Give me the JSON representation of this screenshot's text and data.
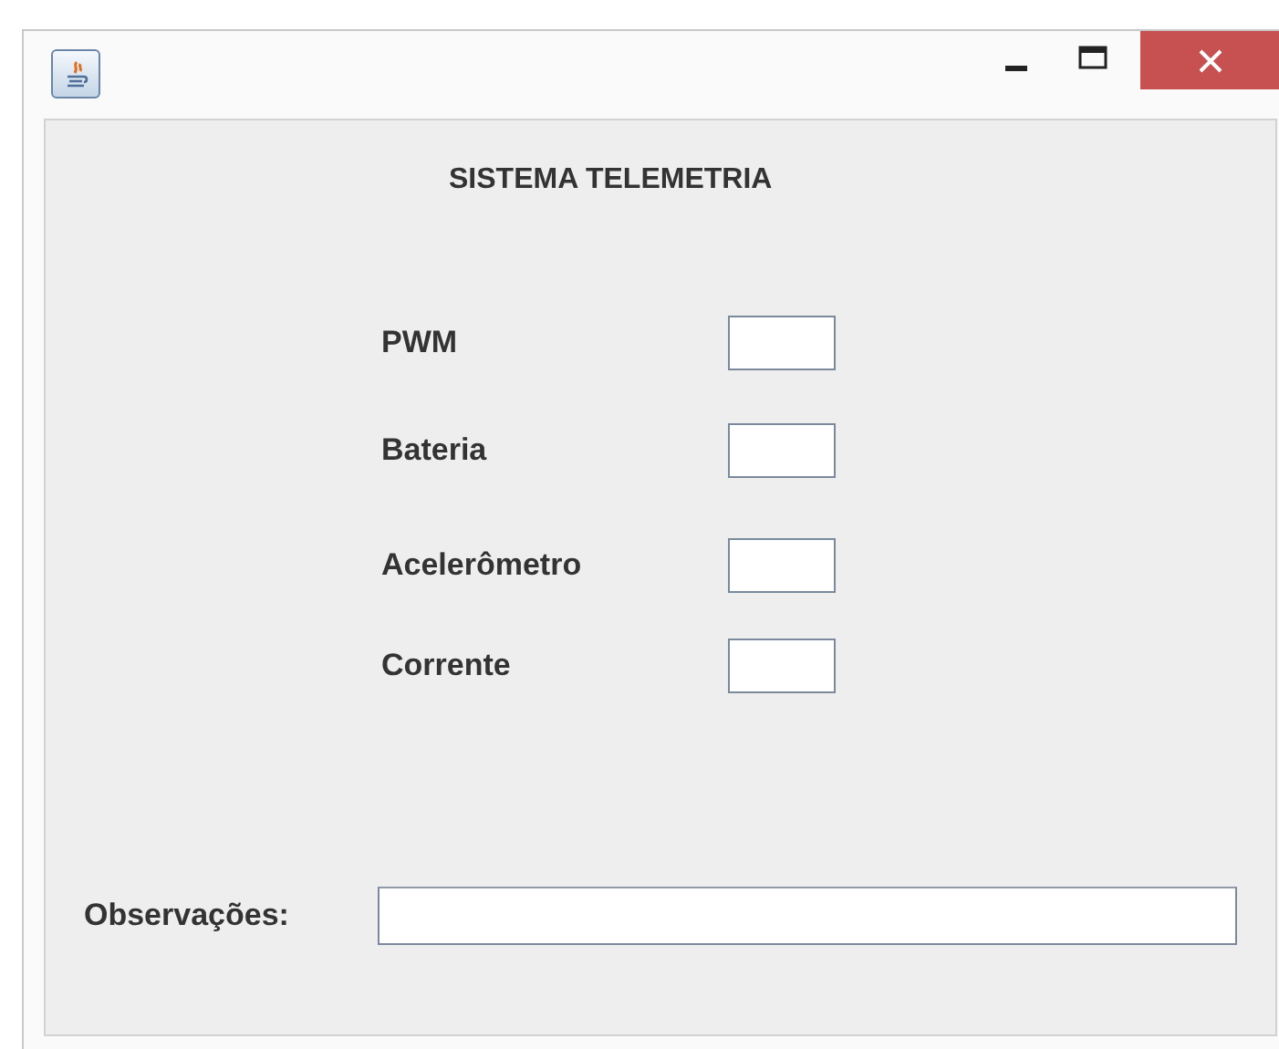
{
  "window": {
    "title_bar": {
      "controls": [
        {
          "kind": "minimize"
        },
        {
          "kind": "maximize"
        },
        {
          "kind": "close"
        }
      ]
    }
  },
  "heading": "SISTEMA TELEMETRIA",
  "fields": [
    {
      "label": "PWM"
    },
    {
      "label": "Bateria"
    },
    {
      "label": "Acelerômetro"
    },
    {
      "label": "Corrente"
    }
  ],
  "notes": {
    "label": "Observações:"
  }
}
